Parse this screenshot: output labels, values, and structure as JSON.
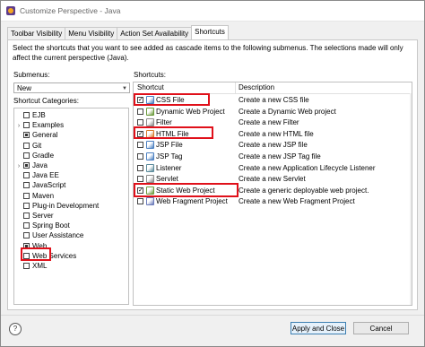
{
  "window": {
    "title": "Customize Perspective - Java"
  },
  "tabs": [
    {
      "label": "Toolbar Visibility",
      "active": false
    },
    {
      "label": "Menu Visibility",
      "active": false
    },
    {
      "label": "Action Set Availability",
      "active": false
    },
    {
      "label": "Shortcuts",
      "active": true
    }
  ],
  "description": "Select the shortcuts that you want to see added as cascade items to the following submenus.  The selections made will only affect the current perspective (Java).",
  "submenus": {
    "label": "Submenus:",
    "selected": "New"
  },
  "categories": {
    "label": "Shortcut Categories:",
    "items": [
      {
        "label": "EJB",
        "expandable": false,
        "check": "none"
      },
      {
        "label": "Examples",
        "expandable": true,
        "check": "none"
      },
      {
        "label": "General",
        "expandable": false,
        "check": "partial"
      },
      {
        "label": "Git",
        "expandable": false,
        "check": "none"
      },
      {
        "label": "Gradle",
        "expandable": false,
        "check": "none"
      },
      {
        "label": "Java",
        "expandable": true,
        "check": "partial"
      },
      {
        "label": "Java EE",
        "expandable": false,
        "check": "none"
      },
      {
        "label": "JavaScript",
        "expandable": false,
        "check": "none"
      },
      {
        "label": "Maven",
        "expandable": false,
        "check": "none"
      },
      {
        "label": "Plug-in Development",
        "expandable": false,
        "check": "none"
      },
      {
        "label": "Server",
        "expandable": false,
        "check": "none"
      },
      {
        "label": "Spring Boot",
        "expandable": false,
        "check": "none"
      },
      {
        "label": "User Assistance",
        "expandable": false,
        "check": "none"
      },
      {
        "label": "Web",
        "expandable": false,
        "check": "partial"
      },
      {
        "label": "Web Services",
        "expandable": false,
        "check": "none"
      },
      {
        "label": "XML",
        "expandable": false,
        "check": "none"
      }
    ]
  },
  "shortcuts": {
    "label": "Shortcuts:",
    "col_shortcut": "Shortcut",
    "col_description": "Description",
    "rows": [
      {
        "name": "CSS File",
        "description": "Create a new CSS file",
        "checked": true,
        "icon_color": "#4a7fc1"
      },
      {
        "name": "Dynamic Web Project",
        "description": "Create a Dynamic Web project",
        "checked": false,
        "icon_color": "#6a9a3a"
      },
      {
        "name": "Filter",
        "description": "Create a new Filter",
        "checked": false,
        "icon_color": "#8a8a8a"
      },
      {
        "name": "HTML File",
        "description": "Create a new HTML file",
        "checked": true,
        "icon_color": "#d8792a"
      },
      {
        "name": "JSP File",
        "description": "Create a new JSP file",
        "checked": false,
        "icon_color": "#4a7fc1"
      },
      {
        "name": "JSP Tag",
        "description": "Create a new JSP Tag file",
        "checked": false,
        "icon_color": "#4a7fc1"
      },
      {
        "name": "Listener",
        "description": "Create a new Application Lifecycle Listener",
        "checked": false,
        "icon_color": "#5a8a9a"
      },
      {
        "name": "Servlet",
        "description": "Create a new Servlet",
        "checked": false,
        "icon_color": "#8a8a8a"
      },
      {
        "name": "Static Web Project",
        "description": "Create a generic deployable web project.",
        "checked": true,
        "icon_color": "#6a9a3a"
      },
      {
        "name": "Web Fragment Project",
        "description": "Create a new Web Fragment Project",
        "checked": false,
        "icon_color": "#6a7aba"
      }
    ]
  },
  "buttons": {
    "help": "?",
    "apply_close": "Apply and Close",
    "cancel": "Cancel"
  },
  "colors": {
    "highlight": "#e0101a",
    "primary_border": "#3c7fb1"
  }
}
